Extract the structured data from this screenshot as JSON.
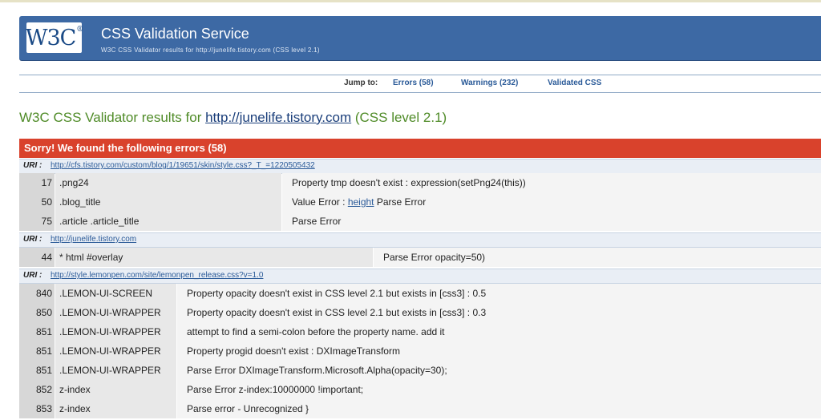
{
  "banner": {
    "logo": "W3C",
    "logo_mark": "®",
    "title": "CSS Validation Service",
    "subtitle": "W3C CSS Validator results for http://junelife.tistory.com (CSS level 2.1)"
  },
  "jump": {
    "label": "Jump to:",
    "errors": "Errors (58)",
    "warnings": "Warnings (232)",
    "validated": "Validated CSS"
  },
  "heading": {
    "prefix": "W3C CSS Validator results for ",
    "url": "http://junelife.tistory.com",
    "suffix": " (CSS level 2.1)"
  },
  "errors_header": "Sorry! We found the following errors (58)",
  "uri_label": "URI :",
  "groups": [
    {
      "uri": "http://cfs.tistory.com/custom/blog/1/19651/skin/style.css?_T_=1220505432",
      "rows": [
        {
          "line": "17",
          "context": ".png24",
          "message": "Property tmp doesn't exist : expression(setPng24(this))"
        },
        {
          "line": "50",
          "context": ".blog_title",
          "message_pre": "Value Error : ",
          "message_link": "height",
          "message_post": " Parse Error"
        },
        {
          "line": "75",
          "context": ".article .article_title",
          "message": "Parse Error"
        }
      ]
    },
    {
      "uri": "http://junelife.tistory.com",
      "rows": [
        {
          "line": "44",
          "context": "* html #overlay",
          "message": "Parse Error opacity=50)"
        }
      ]
    },
    {
      "uri": "http://style.lemonpen.com/site/lemonpen_release.css?v=1.0",
      "rows": [
        {
          "line": "840",
          "context": ".LEMON-UI-SCREEN",
          "message": "Property opacity doesn't exist in CSS level 2.1 but exists in [css3] : 0.5"
        },
        {
          "line": "850",
          "context": ".LEMON-UI-WRAPPER",
          "message": "Property opacity doesn't exist in CSS level 2.1 but exists in [css3] : 0.3"
        },
        {
          "line": "851",
          "context": ".LEMON-UI-WRAPPER",
          "message": "attempt to find a semi-colon before the property name. add it"
        },
        {
          "line": "851",
          "context": ".LEMON-UI-WRAPPER",
          "message": "Property progid doesn't exist : DXImageTransform"
        },
        {
          "line": "851",
          "context": ".LEMON-UI-WRAPPER",
          "message": "Parse Error DXImageTransform.Microsoft.Alpha(opacity=30);"
        },
        {
          "line": "852",
          "context": "z-index",
          "message": "Parse Error z-index:10000000 !important;"
        },
        {
          "line": "853",
          "context": "z-index",
          "message": "Parse error - Unrecognized }"
        }
      ]
    }
  ]
}
